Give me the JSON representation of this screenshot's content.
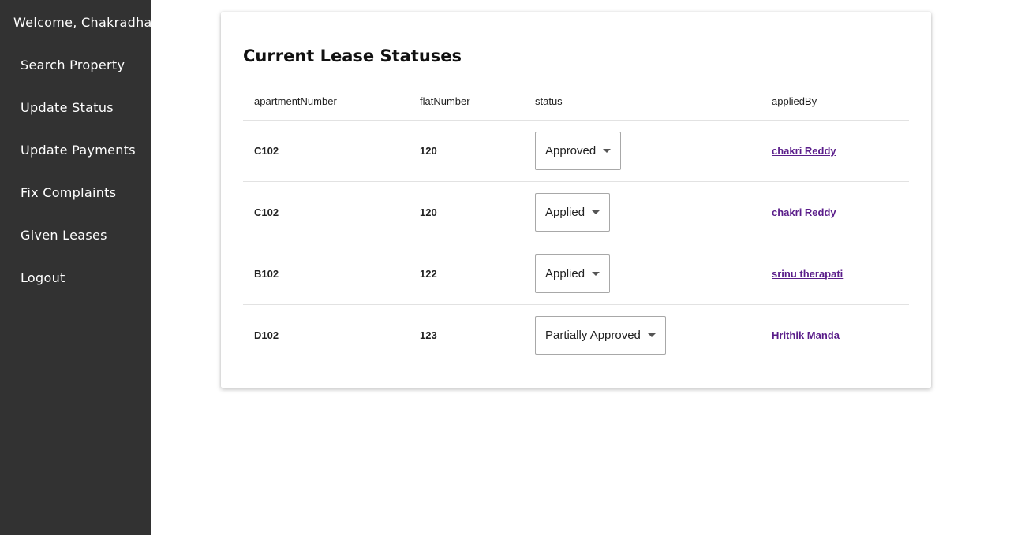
{
  "sidebar": {
    "welcome": "Welcome, Chakradhar",
    "items": [
      {
        "label": "Search Property"
      },
      {
        "label": "Update Status"
      },
      {
        "label": "Update Payments"
      },
      {
        "label": "Fix Complaints"
      },
      {
        "label": "Given Leases"
      },
      {
        "label": "Logout"
      }
    ]
  },
  "main": {
    "title": "Current Lease Statuses",
    "table": {
      "headers": [
        "apartmentNumber",
        "flatNumber",
        "status",
        "appliedBy"
      ],
      "rows": [
        {
          "apartmentNumber": "C102",
          "flatNumber": "120",
          "status": "Approved",
          "appliedBy": "chakri Reddy"
        },
        {
          "apartmentNumber": "C102",
          "flatNumber": "120",
          "status": "Applied",
          "appliedBy": "chakri Reddy"
        },
        {
          "apartmentNumber": "B102",
          "flatNumber": "122",
          "status": "Applied",
          "appliedBy": "srinu therapati"
        },
        {
          "apartmentNumber": "D102",
          "flatNumber": "123",
          "status": "Partially Approved",
          "appliedBy": "Hrithik Manda"
        }
      ]
    }
  },
  "colors": {
    "sidebar_bg": "#323232",
    "link": "#5a1d8a"
  }
}
